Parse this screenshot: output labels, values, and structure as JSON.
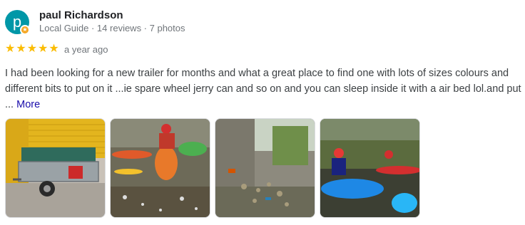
{
  "reviewer": {
    "initial": "p",
    "name": "paul Richardson",
    "meta": "Local Guide · 14 reviews · 7 photos",
    "badge_icon": "local-guide-star"
  },
  "rating": {
    "stars": 5,
    "max": 5,
    "when": "a year ago",
    "star_color": "#fbbc04"
  },
  "review": {
    "text": "I had been looking for a new trailer for months and what a great place to find one with lots of sizes colours and different bits to put on it ...ie spare wheel jerry can and so on and you can sleep inside it with a air bed lol.and put ...",
    "more_label": "More"
  },
  "photos": [
    {
      "subject": "trailer"
    },
    {
      "subject": "kayaker-in-stream"
    },
    {
      "subject": "rubbish-by-wall"
    },
    {
      "subject": "kayaks-on-river"
    }
  ]
}
